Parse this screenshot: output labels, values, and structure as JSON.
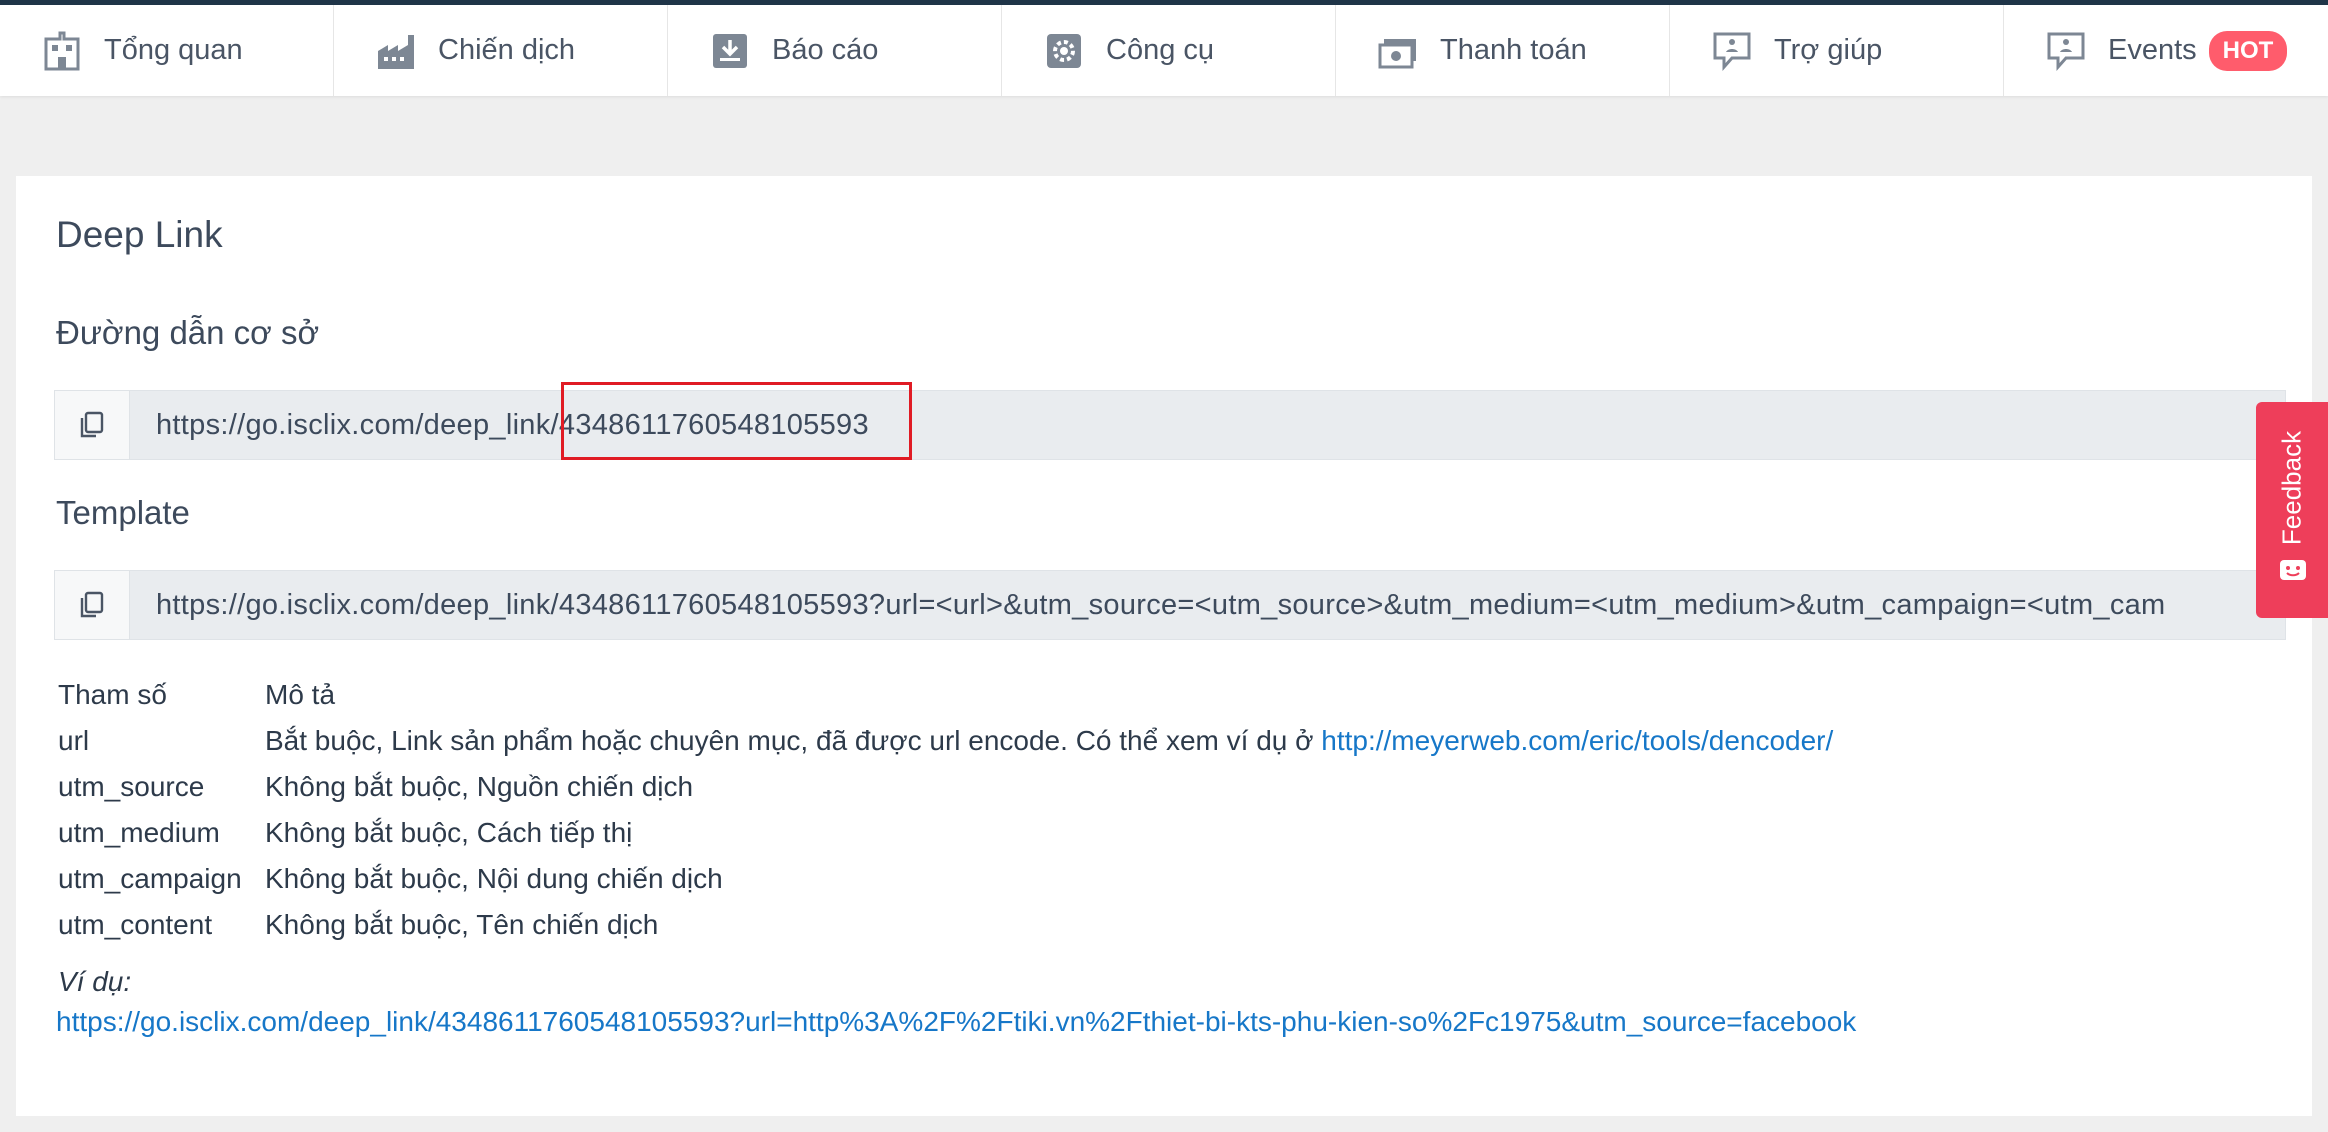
{
  "nav": {
    "items": [
      {
        "label": "Tổng quan",
        "icon": "building-icon"
      },
      {
        "label": "Chiến dịch",
        "icon": "factory-icon"
      },
      {
        "label": "Báo cáo",
        "icon": "download-report-icon"
      },
      {
        "label": "Công cụ",
        "icon": "gear-icon"
      },
      {
        "label": "Thanh toán",
        "icon": "money-icon"
      },
      {
        "label": "Trợ giúp",
        "icon": "help-chat-icon"
      },
      {
        "label": "Events",
        "icon": "events-chat-icon",
        "badge": "HOT"
      }
    ]
  },
  "page": {
    "title": "Deep Link",
    "base_label": "Đường dẫn cơ sở",
    "base_url": "https://go.isclix.com/deep_link/4348611760548105593",
    "template_label": "Template",
    "template_url": "https://go.isclix.com/deep_link/4348611760548105593?url=<url>&utm_source=<utm_source>&utm_medium=<utm_medium>&utm_campaign=<utm_cam"
  },
  "params": {
    "header_name": "Tham số",
    "header_desc": "Mô tả",
    "rows": [
      {
        "name": "url",
        "desc": "Bắt buộc, Link sản phẩm hoặc chuyên mục, đã được url encode. Có thể xem ví dụ ở ",
        "link": "http://meyerweb.com/eric/tools/dencoder/"
      },
      {
        "name": "utm_source",
        "desc": "Không bắt buộc, Nguồn chiến dịch"
      },
      {
        "name": "utm_medium",
        "desc": "Không bắt buộc, Cách tiếp thị"
      },
      {
        "name": "utm_campaign",
        "desc": "Không bắt buộc, Nội dung chiến dịch"
      },
      {
        "name": "utm_content",
        "desc": "Không bắt buộc, Tên chiến dịch"
      }
    ]
  },
  "example": {
    "label": "Ví dụ:",
    "link": "https://go.isclix.com/deep_link/4348611760548105593?url=http%3A%2F%2Ftiki.vn%2Fthiet-bi-kts-phu-kien-so%2Fc1975&utm_source=facebook"
  },
  "feedback": {
    "label": "Feedback"
  },
  "colors": {
    "accent": "#1677c8",
    "hot": "#ff5c6c",
    "feedback": "#ee3e5a",
    "highlight": "#e01b24",
    "topbar_border": "#1f3548"
  }
}
